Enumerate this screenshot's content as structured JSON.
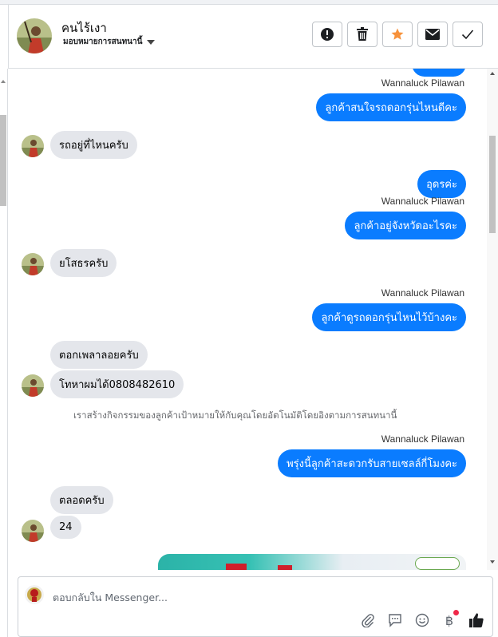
{
  "header": {
    "contact_name": "คนไร้เงา",
    "assign_label": "มอบหมายการสนทนานี้",
    "icons": [
      "alert-icon",
      "trash-icon",
      "star-icon",
      "envelope-icon",
      "check-icon"
    ]
  },
  "messages": [
    {
      "type": "out",
      "sender": "Wannaluck Pilawan",
      "text": "ลูกค้าสนใจรถดอกรุ่นไหนดีคะ"
    },
    {
      "type": "in",
      "text": "รถอยู่ที่ไหนครับ"
    },
    {
      "type": "out",
      "text": "อุดรค่ะ"
    },
    {
      "type": "out",
      "sender": "Wannaluck Pilawan",
      "text": "ลูกค้าอยู่จังหวัดอะไรคะ"
    },
    {
      "type": "in",
      "text": "ยโสธรครับ"
    },
    {
      "type": "out",
      "sender": "Wannaluck Pilawan",
      "text": "ลูกค้าดูรถดอกรุ่นไหนไว้บ้างคะ"
    },
    {
      "type": "in",
      "text": "ตอกเพลาลอยครับ"
    },
    {
      "type": "in",
      "text": "โทหาผมได้0808482610"
    },
    {
      "type": "notice",
      "text": "เราสร้างกิจกรรมของลูกค้าเป้าหมายให้กับคุณโดยอัตโนมัติโดยอิงตามการสนทนานี้"
    },
    {
      "type": "out",
      "sender": "Wannaluck Pilawan",
      "text": "พรุ่งนี้ลูกค้าสะดวกรับสายเซลล์กี่โมงคะ"
    },
    {
      "type": "in",
      "text": "ตลอดครับ"
    },
    {
      "type": "in",
      "text": "24"
    }
  ],
  "composer": {
    "placeholder": "ตอบกลับใน Messenger...",
    "tools": [
      "attach-icon",
      "saved-reply-icon",
      "emoji-icon",
      "baht-icon",
      "thumbs-up-icon"
    ],
    "baht_symbol": "฿"
  },
  "colors": {
    "outgoing_bubble": "#0a7cff",
    "incoming_bubble": "#e4e6eb",
    "star": "#f7923b",
    "badge": "#f02849"
  }
}
